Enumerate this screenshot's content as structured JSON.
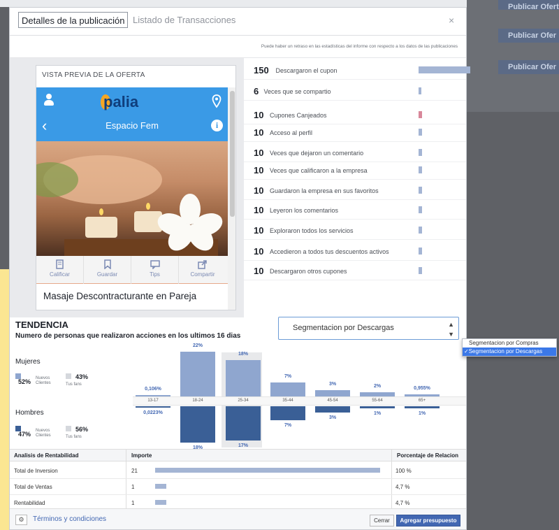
{
  "background": {
    "buttons": [
      "Publicar Oferta",
      "Publicar Ofer",
      "Publicar Ofer"
    ]
  },
  "tabs": {
    "active": "Detalles de la publicación",
    "inactive": "Listado de Transacciones",
    "close": "×"
  },
  "notice": "Puede haber un retraso en las estadísticas del informe con respecto a los datos de las publicaciones",
  "preview": {
    "title": "VISTA PREVIA DE LA OFERTA",
    "logo": "palia",
    "subtitle": "Espacio Fem",
    "actions": [
      {
        "label": "Calificar",
        "icon": "rate-icon"
      },
      {
        "label": "Guardar",
        "icon": "bookmark-icon"
      },
      {
        "label": "Tips",
        "icon": "chat-icon"
      },
      {
        "label": "Compartir",
        "icon": "share-icon"
      }
    ],
    "offer_title": "Masaje Descontracturante en Pareja"
  },
  "stats": [
    {
      "num": "150",
      "label": "Descargaron el cupon",
      "value": 150,
      "highlight": false
    },
    {
      "num": "6",
      "label": "Veces que se compartio",
      "value": 6,
      "highlight": false
    },
    {
      "num": "10",
      "label": "Cupones Canjeados",
      "value": 10,
      "highlight": true
    },
    {
      "num": "10",
      "label": "Acceso al perfil",
      "value": 10,
      "highlight": false
    },
    {
      "num": "10",
      "label": "Veces que dejaron un comentario",
      "value": 10,
      "highlight": false
    },
    {
      "num": "10",
      "label": "Veces que calificaron a la empresa",
      "value": 10,
      "highlight": false
    },
    {
      "num": "10",
      "label": "Guardaron la empresa en sus favoritos",
      "value": 10,
      "highlight": false
    },
    {
      "num": "10",
      "label": "Leyeron los comentarios",
      "value": 10,
      "highlight": false
    },
    {
      "num": "10",
      "label": "Exploraron todos los servicios",
      "value": 10,
      "highlight": false
    },
    {
      "num": "10",
      "label": "Accedieron a todos tus descuentos activos",
      "value": 10,
      "highlight": false
    },
    {
      "num": "10",
      "label": "Descargaron otros cupones",
      "value": 10,
      "highlight": false
    }
  ],
  "tendencia": {
    "title": "TENDENCIA",
    "subtitle": "Numero de personas que realizaron acciones en los ultimos 16 dias",
    "select_value": "Segmentacion por Descargas",
    "select_options": [
      "Segmentacion por Compras",
      "Segmentacion por Descargas"
    ],
    "women": {
      "label": "Mujeres",
      "new_pct": "52%",
      "new_txt": "Nuevos Clientes",
      "fans_pct": "43%",
      "fans_txt": "Tus fans"
    },
    "men": {
      "label": "Hombres",
      "new_pct": "47%",
      "new_txt": "Nuevos Clientes",
      "fans_pct": "56%",
      "fans_txt": "Tus fans"
    },
    "age_groups": [
      {
        "label": "13-17",
        "female": "0,106%",
        "male": "0,0223%",
        "f": 0.106,
        "m": 0.0223
      },
      {
        "label": "18-24",
        "female": "22%",
        "male": "18%",
        "f": 22,
        "m": 18
      },
      {
        "label": "25-34",
        "female": "18%",
        "male": "17%",
        "f": 18,
        "m": 17
      },
      {
        "label": "35-44",
        "female": "7%",
        "male": "7%",
        "f": 7,
        "m": 7
      },
      {
        "label": "45-54",
        "female": "3%",
        "male": "3%",
        "f": 3,
        "m": 3
      },
      {
        "label": "55-64",
        "female": "2%",
        "male": "1%",
        "f": 2,
        "m": 1
      },
      {
        "label": "65+",
        "female": "0,955%",
        "male": "1%",
        "f": 0.955,
        "m": 1
      }
    ]
  },
  "rentabilidad": {
    "headers": [
      "Analisis de Rentabilidad",
      "Importe",
      "Porcentaje de Relacion"
    ],
    "rows": [
      {
        "label": "Total de Inversion",
        "amount": "21",
        "value": 21,
        "pct": "100 %"
      },
      {
        "label": "Total de Ventas",
        "amount": "1",
        "value": 1,
        "pct": "4,7 %"
      },
      {
        "label": "Rentabilidad",
        "amount": "1",
        "value": 1,
        "pct": "4,7 %"
      }
    ]
  },
  "footer": {
    "terms": "Términos y condiciones",
    "cancel": "Cerrar",
    "primary": "Agregar presupuesto"
  },
  "colors": {
    "accent": "#4267b2",
    "bar_light": "#a4b5d4",
    "bar_highlight": "#d8879a",
    "female_bar": "#8fa6cf",
    "male_bar": "#3a5f96",
    "app_blue": "#3a9ae6"
  }
}
